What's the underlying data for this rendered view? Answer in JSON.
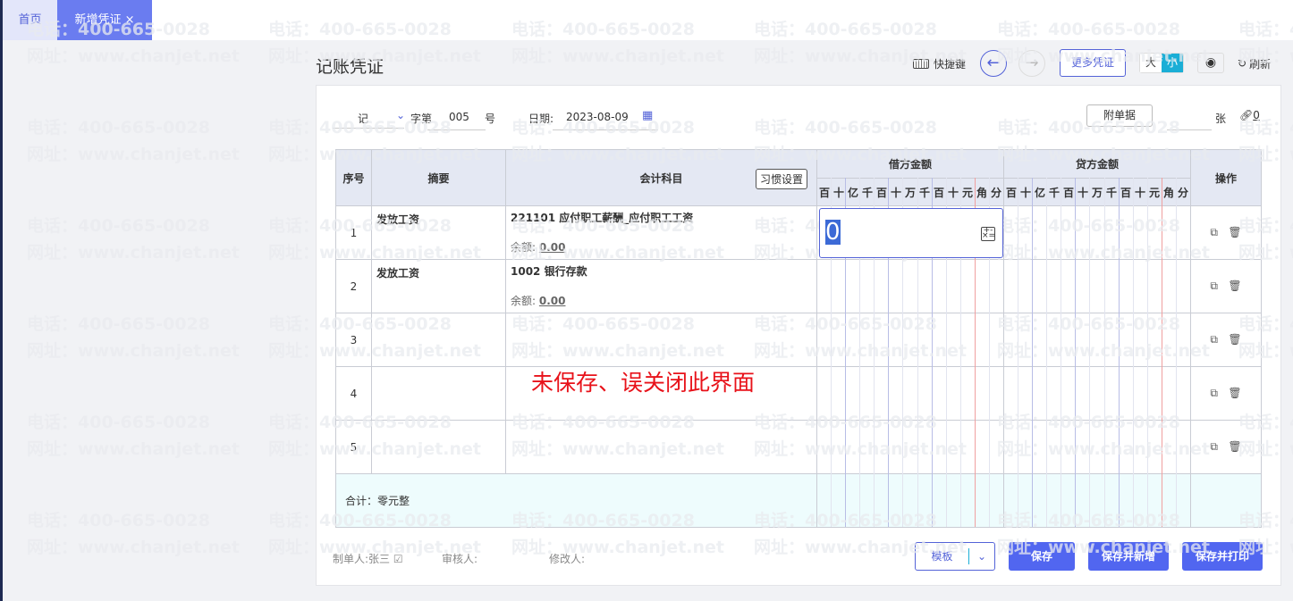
{
  "tabs": [
    {
      "label": "首页"
    },
    {
      "label": "新增凭证",
      "close": "×"
    }
  ],
  "watermark": {
    "line1": "电话：400-665-0028",
    "line2": "网址：www.chanjet.net"
  },
  "page_title": "记账凭证",
  "toolbar": {
    "shortcut": "快捷键",
    "more": "更多凭证",
    "size_large": "大",
    "size_small": "小",
    "refresh": "刷新"
  },
  "voucher": {
    "word": "记",
    "word_label": "字第",
    "number": "005",
    "number_suffix": "号",
    "date_label": "日期:",
    "date": "2023-08-09",
    "attach_button": "附单据",
    "attach_count": "",
    "attach_unit": "张",
    "link_count": "0"
  },
  "table": {
    "headers": {
      "seq": "序号",
      "summary": "摘要",
      "account": "会计科目",
      "habit": "习惯设置",
      "debit": "借方金额",
      "credit": "贷方金额",
      "ops": "操作"
    },
    "digits": [
      "百",
      "十",
      "亿",
      "千",
      "百",
      "十",
      "万",
      "千",
      "百",
      "十",
      "元",
      "角",
      "分"
    ],
    "balance_label": "余额:",
    "rows": [
      {
        "seq": "1",
        "summary": "发放工资",
        "account": "221101 应付职工薪酬_应付职工工资",
        "balance": "0.00",
        "debit_input": "0"
      },
      {
        "seq": "2",
        "summary": "发放工资",
        "account": "1002 银行存款",
        "balance": "0.00"
      },
      {
        "seq": "3",
        "summary": "",
        "account": ""
      },
      {
        "seq": "4",
        "summary": "",
        "account": ""
      },
      {
        "seq": "5",
        "summary": "",
        "account": ""
      }
    ],
    "total": "合计：零元整"
  },
  "overlay_text": "未保存、误关闭此界面",
  "footer": {
    "maker_label": "制单人:",
    "maker": "张三",
    "auditor_label": "审核人:",
    "modifier_label": "修改人:",
    "template": "模板",
    "save": "保存",
    "save_new": "保存并新增",
    "save_print": "保存并打印"
  }
}
